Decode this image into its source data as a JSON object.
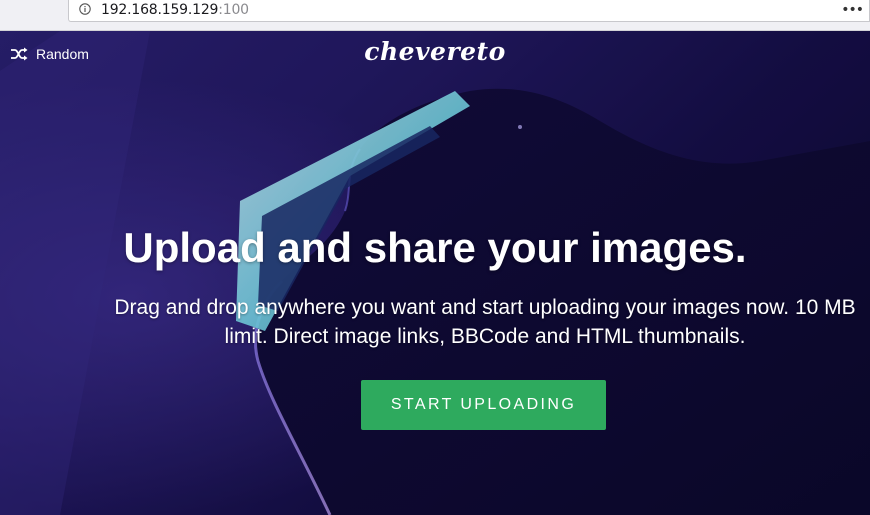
{
  "browser": {
    "url_host": "192.168.159.129",
    "url_port": ":100",
    "info_icon": "info-icon",
    "menu_icon": "more-horizontal-icon",
    "menu_glyph": "•••"
  },
  "header": {
    "random_icon": "shuffle-icon",
    "random_label": "Random",
    "logo_text": "chevereto"
  },
  "hero": {
    "headline": "Upload and share your images.",
    "lead": "Drag and drop anywhere you want and start uploading your images now. 10 MB limit. Direct image links, BBCode and HTML thumbnails.",
    "cta_label": "START UPLOADING",
    "background": "dark-blue-photo-face-with-glasses",
    "accent_color": "#2eaa5e"
  }
}
